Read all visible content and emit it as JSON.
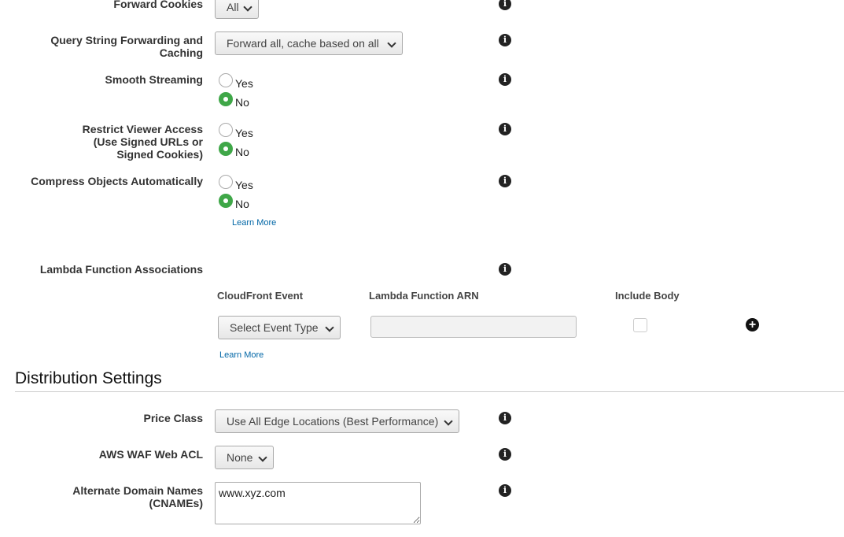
{
  "cache": {
    "forward_cookies": {
      "label": "Forward Cookies",
      "value": "All"
    },
    "query_string": {
      "label_1": "Query String Forwarding and",
      "label_2": "Caching",
      "value": "Forward all, cache based on all"
    },
    "smooth_streaming": {
      "label": "Smooth Streaming",
      "yes": "Yes",
      "no": "No",
      "selected": "No"
    },
    "restrict_viewer": {
      "label_1": "Restrict Viewer Access",
      "label_2": "(Use Signed URLs or",
      "label_3": "Signed Cookies)",
      "yes": "Yes",
      "no": "No",
      "selected": "No"
    },
    "compress": {
      "label": "Compress Objects Automatically",
      "yes": "Yes",
      "no": "No",
      "selected": "No",
      "learn_more": "Learn More"
    }
  },
  "lambda": {
    "label": "Lambda Function Associations",
    "columns": [
      "CloudFront Event",
      "Lambda Function ARN",
      "Include Body"
    ],
    "event_select": "Select Event Type",
    "arn_value": "",
    "include_body": false,
    "learn_more": "Learn More"
  },
  "distribution": {
    "heading": "Distribution Settings",
    "price_class": {
      "label": "Price Class",
      "value": "Use All Edge Locations (Best Performance)"
    },
    "waf": {
      "label": "AWS WAF Web ACL",
      "value": "None"
    },
    "cnames": {
      "label_1": "Alternate Domain Names",
      "label_2": "(CNAMEs)",
      "value": "www.xyz.com"
    }
  },
  "icons": {
    "info": "info-icon",
    "add": "plus-circle-icon"
  },
  "colors": {
    "radio_selected": "#3fa748",
    "link": "#0066a6"
  }
}
